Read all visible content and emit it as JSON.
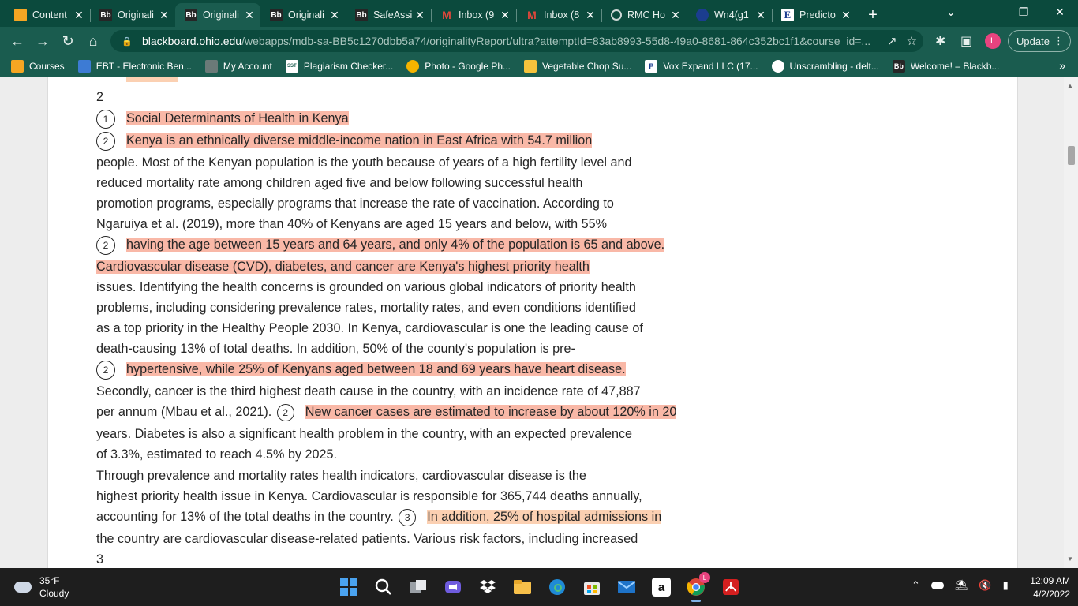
{
  "browser": {
    "tabs": [
      {
        "title": "Content",
        "favicon": "pencil-icon",
        "active": false
      },
      {
        "title": "Originali",
        "favicon": "bb-icon",
        "active": false
      },
      {
        "title": "Originali",
        "favicon": "bb-icon",
        "active": true
      },
      {
        "title": "Originali",
        "favicon": "bb-icon",
        "active": false
      },
      {
        "title": "SafeAssi",
        "favicon": "bb-icon",
        "active": false
      },
      {
        "title": "Inbox (9",
        "favicon": "gmail-icon",
        "active": false
      },
      {
        "title": "Inbox (8",
        "favicon": "gmail-icon",
        "active": false
      },
      {
        "title": "RMC Ho",
        "favicon": "loading-icon",
        "active": false
      },
      {
        "title": "Wn4(g1",
        "favicon": "circle-icon",
        "active": false
      },
      {
        "title": "Predicto",
        "favicon": "e-icon",
        "active": false
      }
    ],
    "favicon_glyphs": {
      "bb": "Bb",
      "m": "M",
      "e": "E"
    },
    "address": {
      "host": "blackboard.ohio.edu",
      "path": "/webapps/mdb-sa-BB5c1270dbb5a74/originalityReport/ultra?attemptId=83ab8993-55d8-49a0-8681-864c352bc1f1&course_id=..."
    },
    "profile_initial": "L",
    "update_label": "Update",
    "bookmarks": [
      {
        "label": "Courses",
        "icon": "pencil-icon"
      },
      {
        "label": "EBT - Electronic Ben...",
        "icon": "ebt-icon"
      },
      {
        "label": "My Account",
        "icon": "account-icon"
      },
      {
        "label": "Plagiarism Checker...",
        "icon": "sst-icon"
      },
      {
        "label": "Photo - Google Ph...",
        "icon": "pinwheel-icon"
      },
      {
        "label": "Vegetable Chop Su...",
        "icon": "heart-icon"
      },
      {
        "label": "Vox Expand LLC (17...",
        "icon": "paypal-icon"
      },
      {
        "label": "Unscrambling - delt...",
        "icon": "globe-icon"
      },
      {
        "label": "Welcome! – Blackb...",
        "icon": "bb-icon"
      }
    ],
    "bookmark_glyphs": {
      "sst": "SST",
      "paypal": "P",
      "bb": "Bb"
    }
  },
  "document": {
    "page_number_top": "2",
    "lines": [
      {
        "badge": "1",
        "segments": [
          {
            "text": "Social Determinants of Health in Kenya",
            "hl": "a"
          }
        ]
      },
      {
        "badge": "2",
        "segments": [
          {
            "text": "Kenya is an ethnically diverse middle-income nation in East Africa with 54.7 million",
            "hl": "a"
          }
        ]
      },
      {
        "segments": [
          {
            "text": "people. Most of the Kenyan population is the youth because of years of a high fertility level and"
          }
        ]
      },
      {
        "segments": [
          {
            "text": "reduced mortality rate among children aged five and below following successful health"
          }
        ]
      },
      {
        "segments": [
          {
            "text": "promotion programs, especially programs that increase the rate of vaccination. According to"
          }
        ]
      },
      {
        "segments": [
          {
            "text": "Ngaruiya et al. (2019), more than 40% of Kenyans are aged 15 years and below, with 55%"
          }
        ]
      },
      {
        "badge": "2",
        "segments": [
          {
            "text": "having the age between 15 years and 64 years, and only 4% of the population is 65 and above.",
            "hl": "a"
          }
        ]
      },
      {
        "segments": [
          {
            "text": "Cardiovascular disease (CVD), diabetes, and cancer are Kenya's highest priority health",
            "hl": "a"
          }
        ]
      },
      {
        "segments": [
          {
            "text": "issues. Identifying the health concerns is grounded on various global indicators of priority health"
          }
        ]
      },
      {
        "segments": [
          {
            "text": "problems, including considering prevalence rates, mortality rates, and even conditions identified"
          }
        ]
      },
      {
        "segments": [
          {
            "text": "as a top priority in the Healthy People 2030. In Kenya, cardiovascular is one the leading cause of"
          }
        ]
      },
      {
        "segments": [
          {
            "text": "death-causing 13% of total deaths. In addition, 50% of the county's population is pre-"
          }
        ]
      },
      {
        "badge": "2",
        "segments": [
          {
            "text": "hypertensive, while 25% of Kenyans aged between 18 and 69 years have heart disease.",
            "hl": "a"
          }
        ]
      },
      {
        "segments": [
          {
            "text": "Secondly, cancer is the third highest death cause in the country, with an incidence rate of 47,887"
          }
        ]
      },
      {
        "segments": [
          {
            "text": "per annum (Mbau et al., 2021). "
          },
          {
            "badge": "2"
          },
          {
            "text": "New cancer cases are estimated to increase by about 120% in 20",
            "hl": "a"
          }
        ]
      },
      {
        "segments": [
          {
            "text": "years. Diabetes is also a significant health problem in the country, with an expected prevalence"
          }
        ]
      },
      {
        "segments": [
          {
            "text": "of 3.3%, estimated to reach 4.5% by 2025."
          }
        ]
      },
      {
        "segments": [
          {
            "text": "Through prevalence and mortality rates health indicators, cardiovascular disease is the"
          }
        ]
      },
      {
        "segments": [
          {
            "text": "highest priority health issue in Kenya. Cardiovascular is responsible for 365,744 deaths annually,"
          }
        ]
      },
      {
        "segments": [
          {
            "text": "accounting for 13% of the total deaths in the country. "
          },
          {
            "badge": "3"
          },
          {
            "text": "In addition, 25% of hospital admissions in",
            "hl": "b"
          }
        ]
      },
      {
        "segments": [
          {
            "text": "the country are cardiovascular disease-related patients. Various risk factors, including increased"
          }
        ]
      }
    ],
    "page_number_bottom": "3"
  },
  "taskbar": {
    "weather_temp": "35°F",
    "weather_desc": "Cloudy",
    "time": "12:09 AM",
    "date": "4/2/2022",
    "amazon_glyph": "a",
    "chrome_badge": "L"
  },
  "colors": {
    "chrome_frame": "#0b4a3d",
    "chrome_toolbar": "#1a5c4f",
    "highlight_primary": "#f9b8a7",
    "highlight_secondary": "#fbd0b2"
  }
}
